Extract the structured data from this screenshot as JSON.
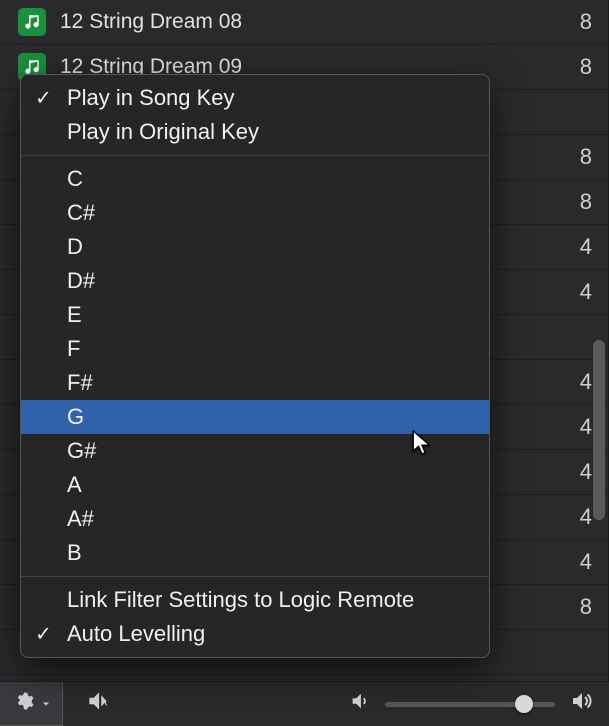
{
  "rows": [
    {
      "icon": "loop",
      "label": "12 String Dream 08",
      "count": "8"
    },
    {
      "icon": "loop",
      "label": "12 String Dream 09",
      "count": "8"
    },
    {
      "icon": "wave",
      "label": "",
      "count": ""
    },
    {
      "icon": "wave",
      "label": "",
      "count": "8"
    },
    {
      "icon": "wave",
      "label": "",
      "count": "8"
    },
    {
      "icon": "wave",
      "label": "",
      "count": "4"
    },
    {
      "icon": "wave",
      "label": "",
      "count": "4"
    },
    {
      "icon": "wave",
      "label": "",
      "count": ""
    },
    {
      "icon": "wave",
      "label": "",
      "count": "4"
    },
    {
      "icon": "wave",
      "label": "",
      "count": "4"
    },
    {
      "icon": "wave",
      "label": "",
      "count": "4"
    },
    {
      "icon": "wave",
      "label": "",
      "count": "4"
    },
    {
      "icon": "wave",
      "label": "",
      "count": "4"
    },
    {
      "icon": "wave",
      "label": "",
      "count": "8"
    },
    {
      "icon": "wave",
      "label": "",
      "count": ""
    }
  ],
  "menu": {
    "top": [
      {
        "label": "Play in Song Key",
        "checked": true
      },
      {
        "label": "Play in Original Key",
        "checked": false
      }
    ],
    "keys": [
      "C",
      "C#",
      "D",
      "D#",
      "E",
      "F",
      "F#",
      "G",
      "G#",
      "A",
      "A#",
      "B"
    ],
    "highlighted_key": "G",
    "bottom": [
      {
        "label": "Link Filter Settings to Logic Remote",
        "checked": false
      },
      {
        "label": "Auto Levelling",
        "checked": true
      }
    ]
  }
}
